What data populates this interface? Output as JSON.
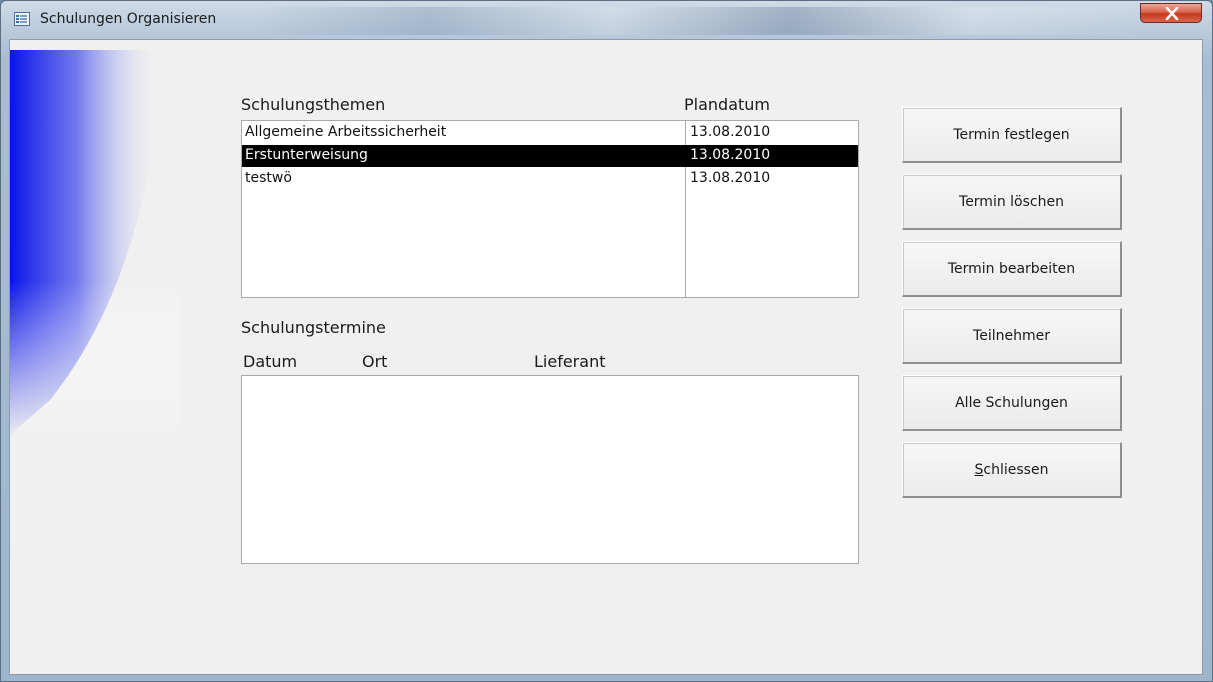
{
  "window": {
    "title": "Schulungen Organisieren"
  },
  "themen": {
    "label": "Schulungsthemen",
    "date_header": "Plandatum",
    "rows": [
      {
        "name": "Allgemeine Arbeitssicherheit",
        "date": "13.08.2010",
        "selected": false
      },
      {
        "name": "Erstunterweisung",
        "date": "13.08.2010",
        "selected": true
      },
      {
        "name": "testwö",
        "date": "13.08.2010",
        "selected": false
      }
    ]
  },
  "termine": {
    "label": "Schulungstermine",
    "headers": {
      "datum": "Datum",
      "ort": "Ort",
      "lieferant": "Lieferant"
    }
  },
  "buttons": {
    "termin_festlegen": "Termin festlegen",
    "termin_loeschen": "Termin löschen",
    "termin_bearbeiten": "Termin bearbeiten",
    "teilnehmer": "Teilnehmer",
    "alle_schulungen": "Alle Schulungen",
    "schliessen_first": "S",
    "schliessen_rest": "chliessen"
  },
  "icons": {
    "app": "form-icon",
    "close": "close-x-icon"
  },
  "colors": {
    "selection": "#000000",
    "close_button": "#c5381f"
  }
}
